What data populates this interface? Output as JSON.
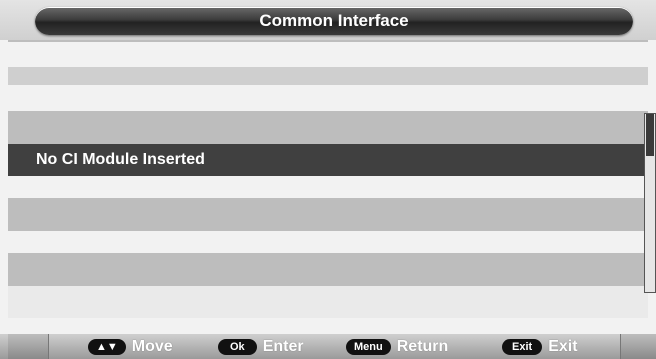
{
  "header": {
    "title": "Common Interface"
  },
  "list": {
    "selected_item": "No CI Module Inserted"
  },
  "footer": {
    "hints": [
      {
        "key": "▲▼",
        "label": "Move"
      },
      {
        "key": "Ok",
        "label": "Enter"
      },
      {
        "key": "Menu",
        "label": "Return"
      },
      {
        "key": "Exit",
        "label": "Exit"
      }
    ]
  },
  "colors": {
    "title_bar": "#2e2e2e",
    "selected_row": "#404040",
    "stripe_light": "#f2f2f2",
    "stripe_dark": "#bdbdbd"
  }
}
